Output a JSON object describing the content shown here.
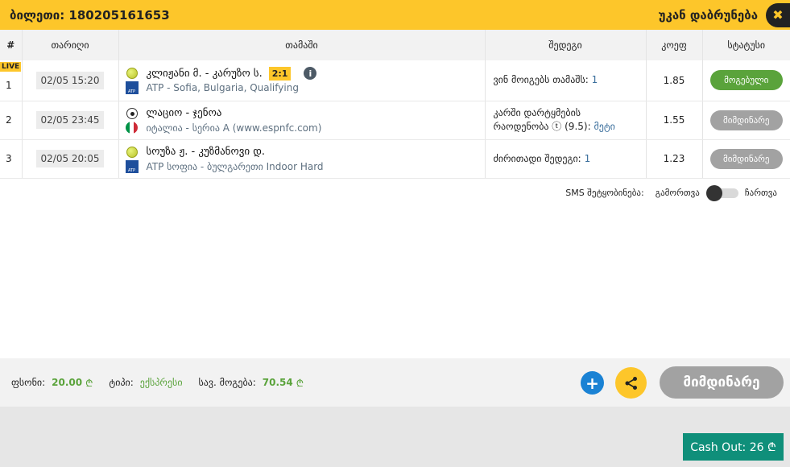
{
  "header": {
    "ticket": "ბილეთი: 180205161653",
    "back_label": "უკან დაბრუნება",
    "close_glyph": "✖"
  },
  "table": {
    "columns": [
      "#",
      "თარიღი",
      "თამაში",
      "შედეგი",
      "კოეფ",
      "სტატუსი"
    ],
    "rows": [
      {
        "num": "1",
        "live": "LIVE",
        "date": "02/05 15:20",
        "sport_icon": "tennis-ball-icon",
        "match": "კლიჟანი მ. - კარუზო ს.",
        "score": "2:1",
        "info": "i",
        "league_icon": "atp-logo-icon",
        "league_link": "ATP",
        "league_rest": " - Sofia, Bulgaria, Qualifying",
        "outcome_prefix": "ვინ მოიგებს თამაშს:",
        "outcome_value": "1",
        "outcome_line1": "",
        "odds": "1.85",
        "status": "მოგებული",
        "status_kind": "won"
      },
      {
        "num": "2",
        "date": "02/05 23:45",
        "sport_icon": "soccer-ball-icon",
        "match": "ლაციო - ჯენოა",
        "league_icon": "italy-flag-icon",
        "league_link": "იტალია",
        "league_rest": " - სერია A (www.espnfc.com)",
        "outcome_line1": "კარში დარტყმების",
        "outcome_prefix": "რაოდენობა ⓣ (9.5):",
        "outcome_value": "მეტი",
        "odds": "1.55",
        "status": "მიმდინარე",
        "status_kind": "pending"
      },
      {
        "num": "3",
        "date": "02/05 20:05",
        "sport_icon": "tennis-ball-icon",
        "match": "სოუზა ჟ. - კუზმანოვი დ.",
        "league_icon": "atp-logo-icon",
        "league_link": "ATP სოფია",
        "league_rest": " - ბულგარეთი Indoor Hard",
        "outcome_line1": "",
        "outcome_prefix": "ძირითადი შედეგი:",
        "outcome_value": "1",
        "odds": "1.23",
        "status": "მიმდინარე",
        "status_kind": "pending"
      }
    ]
  },
  "sms": {
    "label": "SMS შეტყობინება:",
    "off": "გამორთვა",
    "on": "ჩართვა",
    "enabled": false
  },
  "footer": {
    "stake_label": "ფსონი:",
    "stake_value": "20.00",
    "currency": "₾",
    "type_label": "ტიპი:",
    "type_value": "ექსპრესი",
    "win_label": "სავ. მოგება:",
    "win_value": "70.54",
    "plus": "+",
    "status_big": "მიმდინარე"
  },
  "cashout": {
    "label": "Cash Out: 26 ₾"
  },
  "colors": {
    "brand_yellow": "#fdc62a",
    "won_green": "#5aa33b",
    "pending_grey": "#a2a2a2",
    "cashout_teal": "#0f8f7a",
    "plus_blue": "#1a82d4"
  }
}
